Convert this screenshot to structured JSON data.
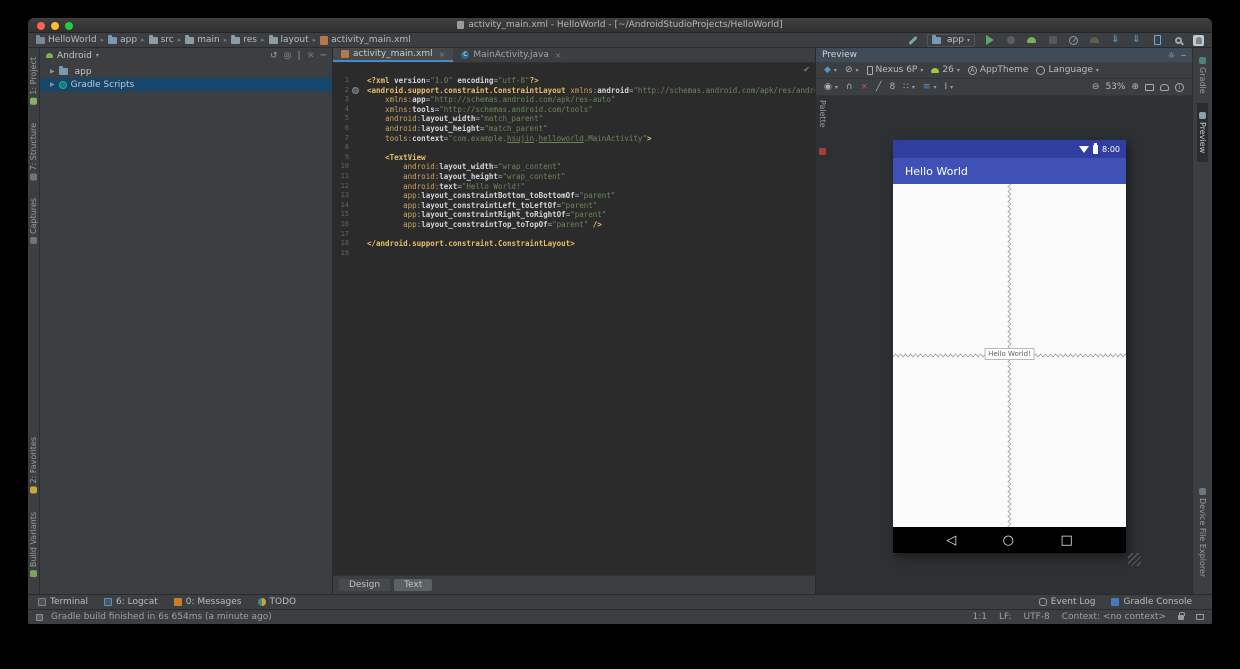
{
  "window": {
    "title": "activity_main.xml - HelloWorld - [~/AndroidStudioProjects/HelloWorld]"
  },
  "navbar": {
    "breadcrumbs": [
      {
        "label": "HelloWorld",
        "icon": "project-folder-icon"
      },
      {
        "label": "app",
        "icon": "module-folder-icon"
      },
      {
        "label": "src",
        "icon": "folder-icon"
      },
      {
        "label": "main",
        "icon": "folder-icon"
      },
      {
        "label": "res",
        "icon": "folder-icon"
      },
      {
        "label": "layout",
        "icon": "folder-icon"
      },
      {
        "label": "activity_main.xml",
        "icon": "layout-file-icon"
      }
    ],
    "run_config": "app"
  },
  "left_stripe": {
    "top": [
      {
        "label": "1: Project",
        "icon": "project-tool-icon"
      },
      {
        "label": "7: Structure",
        "icon": "structure-tool-icon"
      },
      {
        "label": "Captures",
        "icon": "captures-tool-icon"
      }
    ],
    "bottom": [
      {
        "label": "2: Favorites",
        "icon": "favorites-tool-icon"
      },
      {
        "label": "Build Variants",
        "icon": "build-variants-tool-icon"
      }
    ]
  },
  "right_stripe": {
    "top": [
      {
        "label": "Gradle",
        "icon": "gradle-tool-icon",
        "active": false
      },
      {
        "label": "Preview",
        "icon": "preview-tool-icon",
        "active": true
      }
    ],
    "bottom": [
      {
        "label": "Device File Explorer",
        "icon": "device-file-explorer-tool-icon",
        "active": false
      }
    ]
  },
  "project_panel": {
    "selector": "Android",
    "items": [
      {
        "label": "app",
        "icon": "folder-icon",
        "selected": false
      },
      {
        "label": "Gradle Scripts",
        "icon": "gradle-icon",
        "selected": true
      }
    ]
  },
  "editor": {
    "tabs": [
      {
        "label": "activity_main.xml",
        "icon": "layout-file-icon",
        "active": true
      },
      {
        "label": "MainActivity.java",
        "icon": "class-file-icon",
        "active": false
      }
    ],
    "bottom_tabs": [
      {
        "label": "Design",
        "active": false
      },
      {
        "label": "Text",
        "active": true
      }
    ],
    "code": [
      [
        [
          "tg",
          "<?xml "
        ],
        [
          "at",
          "version"
        ],
        [
          "pl",
          "="
        ],
        [
          "vl",
          "\"1.0\""
        ],
        [
          "pl",
          " "
        ],
        [
          "at",
          "encoding"
        ],
        [
          "pl",
          "="
        ],
        [
          "vl",
          "\"utf-8\""
        ],
        [
          "tg",
          "?>"
        ]
      ],
      [
        [
          "tg",
          "<android.support.constraint.ConstraintLayout "
        ],
        [
          "ns",
          "xmlns:"
        ],
        [
          "at",
          "android"
        ],
        [
          "pl",
          "="
        ],
        [
          "vl",
          "\"http://schemas.android.com/apk/res/android\""
        ]
      ],
      [
        [
          "pl",
          "    "
        ],
        [
          "ns",
          "xmlns:"
        ],
        [
          "at",
          "app"
        ],
        [
          "pl",
          "="
        ],
        [
          "vl",
          "\"http://schemas.android.com/apk/res-auto\""
        ]
      ],
      [
        [
          "pl",
          "    "
        ],
        [
          "ns",
          "xmlns:"
        ],
        [
          "at",
          "tools"
        ],
        [
          "pl",
          "="
        ],
        [
          "vl",
          "\"http://schemas.android.com/tools\""
        ]
      ],
      [
        [
          "pl",
          "    "
        ],
        [
          "ns",
          "android:"
        ],
        [
          "at",
          "layout_width"
        ],
        [
          "pl",
          "="
        ],
        [
          "vl",
          "\"match_parent\""
        ]
      ],
      [
        [
          "pl",
          "    "
        ],
        [
          "ns",
          "android:"
        ],
        [
          "at",
          "layout_height"
        ],
        [
          "pl",
          "="
        ],
        [
          "vl",
          "\"match_parent\""
        ]
      ],
      [
        [
          "pl",
          "    "
        ],
        [
          "ns",
          "tools:"
        ],
        [
          "at",
          "context"
        ],
        [
          "pl",
          "="
        ],
        [
          "vl",
          "\"com.example."
        ],
        [
          "lk",
          "hsujin"
        ],
        [
          "vl",
          "."
        ],
        [
          "lk",
          "helloworld"
        ],
        [
          "vl",
          ".MainActivity\""
        ],
        [
          "tg",
          ">"
        ]
      ],
      [],
      [
        [
          "pl",
          "    "
        ],
        [
          "tg",
          "<TextView"
        ]
      ],
      [
        [
          "pl",
          "        "
        ],
        [
          "ns",
          "android:"
        ],
        [
          "at",
          "layout_width"
        ],
        [
          "pl",
          "="
        ],
        [
          "vl",
          "\"wrap_content\""
        ]
      ],
      [
        [
          "pl",
          "        "
        ],
        [
          "ns",
          "android:"
        ],
        [
          "at",
          "layout_height"
        ],
        [
          "pl",
          "="
        ],
        [
          "vl",
          "\"wrap_content\""
        ]
      ],
      [
        [
          "pl",
          "        "
        ],
        [
          "ns",
          "android:"
        ],
        [
          "at",
          "text"
        ],
        [
          "pl",
          "="
        ],
        [
          "vl",
          "\"Hello World!\""
        ]
      ],
      [
        [
          "pl",
          "        "
        ],
        [
          "ns",
          "app:"
        ],
        [
          "at",
          "layout_constraintBottom_toBottomOf"
        ],
        [
          "pl",
          "="
        ],
        [
          "vl",
          "\"parent\""
        ]
      ],
      [
        [
          "pl",
          "        "
        ],
        [
          "ns",
          "app:"
        ],
        [
          "at",
          "layout_constraintLeft_toLeftOf"
        ],
        [
          "pl",
          "="
        ],
        [
          "vl",
          "\"parent\""
        ]
      ],
      [
        [
          "pl",
          "        "
        ],
        [
          "ns",
          "app:"
        ],
        [
          "at",
          "layout_constraintRight_toRightOf"
        ],
        [
          "pl",
          "="
        ],
        [
          "vl",
          "\"parent\""
        ]
      ],
      [
        [
          "pl",
          "        "
        ],
        [
          "ns",
          "app:"
        ],
        [
          "at",
          "layout_constraintTop_toTopOf"
        ],
        [
          "pl",
          "="
        ],
        [
          "vl",
          "\"parent\""
        ],
        [
          "pl",
          " "
        ],
        [
          "tg",
          "/>"
        ]
      ],
      [],
      [
        [
          "tg",
          "</android.support.constraint.ConstraintLayout>"
        ]
      ],
      []
    ]
  },
  "preview": {
    "title": "Preview",
    "device": "Nexus 6P",
    "api_level": "26",
    "theme": "AppTheme",
    "language": "Language",
    "default_margin": "8",
    "zoom_level": "53%",
    "palette_label": "Palette",
    "phone": {
      "time": "8:00",
      "appbar_title": "Hello World",
      "label_text": "Hello World!",
      "colors": {
        "statusbar": "#303F9F",
        "appbar": "#3F51B5"
      }
    }
  },
  "bottom_bar": {
    "left": [
      {
        "label": "Terminal",
        "icon": "terminal-icon"
      },
      {
        "label": "6: Logcat",
        "icon": "logcat-icon"
      },
      {
        "label": "0: Messages",
        "icon": "messages-icon"
      },
      {
        "label": "TODO",
        "icon": "todo-icon"
      }
    ],
    "right": [
      {
        "label": "Event Log",
        "icon": "event-log-icon"
      },
      {
        "label": "Gradle Console",
        "icon": "gradle-console-icon"
      }
    ]
  },
  "statusbar": {
    "message": "Gradle build finished in 6s 654ms (a minute ago)",
    "position": "1:1",
    "line_separator": "LF:",
    "encoding": "UTF-8",
    "context": "Context: <no context>"
  },
  "icons": {
    "back-icon": "◁",
    "home-icon": "○",
    "recents-icon": "□",
    "zoom-out-icon": "⊖",
    "zoom-in-icon": "⊕",
    "eye-icon": "◉",
    "align-icon": "≡",
    "grid-icon": "∷",
    "guideline-icon": "I",
    "magnet-icon": "∩",
    "clear-constraints-icon": "×",
    "infer-constraints-icon": "╱",
    "layers-icon": "◆",
    "orientation-icon": "⊘",
    "sync-icon": "↺",
    "locate-icon": "◎",
    "settings-icon": "☼",
    "hide-icon": "─",
    "check-icon": "✔",
    "sdk-download-icon": "⇓"
  }
}
